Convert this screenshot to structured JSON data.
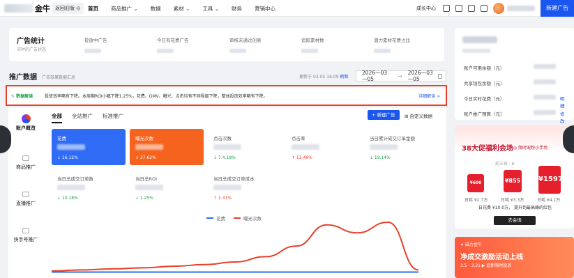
{
  "topbar": {
    "brand": "金牛",
    "back_label": "返回旧版 ◎",
    "nav": [
      "首页",
      "商品推广 ⌄",
      "数据",
      "素材 ⌄",
      "工具 ⌄",
      "财务",
      "营销中心"
    ],
    "growth": "成长中心",
    "new_ad": "新建广告"
  },
  "stats": {
    "title": "广告统计",
    "subtitle": "实时的广告状态",
    "cols": [
      "投放中广告",
      "今日有花费广告",
      "审核未通过创意",
      "追踪素材数",
      "潜力素材花费占比"
    ]
  },
  "account": {
    "rows": [
      {
        "label": "账户可用余额（元）",
        "link": ""
      },
      {
        "label": "共享钱包余额（元）",
        "link": ""
      },
      {
        "label": "今日实时花费（元）",
        "link": "明细"
      },
      {
        "label": "账户推广预算（元）",
        "link": "修改"
      }
    ]
  },
  "promotion": {
    "title": "推广数据",
    "subtitle": "广告效果数据汇总",
    "updated": "更新于 03-05 16:09",
    "refresh": "刷新",
    "date_from": "2026—03—05",
    "date_to": "2026—03—05"
  },
  "notice": {
    "tag": "✎ 数据解读",
    "text": "投放效率略有下降。本周期ROI小幅下降1.25%，花费、GMV、曝光、点击均有不同程度下降，整体投放效率略有下降。",
    "detail": "详细解读 >"
  },
  "sidebar": {
    "items": [
      "账户概览",
      "商品推广",
      "直播推广",
      "快手号推广"
    ]
  },
  "tabs": [
    "全部",
    "全站推广",
    "标准推广"
  ],
  "buttons": {
    "new_ad": "+ 新建广告",
    "custom": "⊞ 自定义数据"
  },
  "metrics": [
    {
      "label": "花费",
      "change": "↓ 16.12%",
      "style": "blue"
    },
    {
      "label": "曝光次数",
      "change": "↓ 37.62%",
      "style": "orange"
    },
    {
      "label": "点击次数",
      "change": "↓ 7.4.18%",
      "style": "plain",
      "dir": "down"
    },
    {
      "label": "点击率",
      "change": "↑ 11.46%",
      "style": "plain",
      "dir": "up"
    },
    {
      "label": "当日累计成交订单金额",
      "change": "↓ 19.14%",
      "style": "plain",
      "dir": "down"
    },
    {
      "label": "当日总成交订单数",
      "change": "↓ 10.18%",
      "style": "plain",
      "dir": "down"
    },
    {
      "label": "当日总ROI",
      "change": "↓ 1.25%",
      "style": "plain",
      "dir": "down"
    },
    {
      "label": "当日总成交订单成本",
      "change": "↑ 1.31%",
      "style": "plain",
      "dir": "up"
    }
  ],
  "chart_data": {
    "type": "line",
    "series": [
      {
        "name": "花费",
        "color": "#2f6bf5",
        "values": [
          0.06,
          0.06,
          0.06,
          0.06,
          0.06,
          0.06,
          0.06,
          0.06,
          0.06,
          0.06,
          0.06,
          0.06,
          0.06
        ]
      },
      {
        "name": "曝光次数",
        "color": "#e8402a",
        "values": [
          0.08,
          0.1,
          0.12,
          0.14,
          0.17,
          0.2,
          0.25,
          0.35,
          0.55,
          0.95,
          0.8,
          1.0,
          0.1
        ]
      }
    ],
    "grid": false,
    "legend": "top-center"
  },
  "promo": {
    "title": "38大促福利会场",
    "subtitle": "◎ 限时宠粉小手场",
    "badge": "前三名  ·  6",
    "coupons": [
      {
        "amount": "¥608",
        "cap": "日耗 ¥2.7万"
      },
      {
        "amount": "¥855",
        "cap": "日耗 ¥3.3万"
      },
      {
        "amount": "¥1597",
        "cap": "日耗 ¥4.1万"
      }
    ],
    "line": "日花费 ¥10.0万，  提升到最高峰的红包",
    "button": "去会场"
  },
  "promo2": {
    "top": "✦ 磁力金牛",
    "title": "净成交激励活动上线",
    "sub": "3.5 - 3.31  ▶ 追新限时投放"
  }
}
